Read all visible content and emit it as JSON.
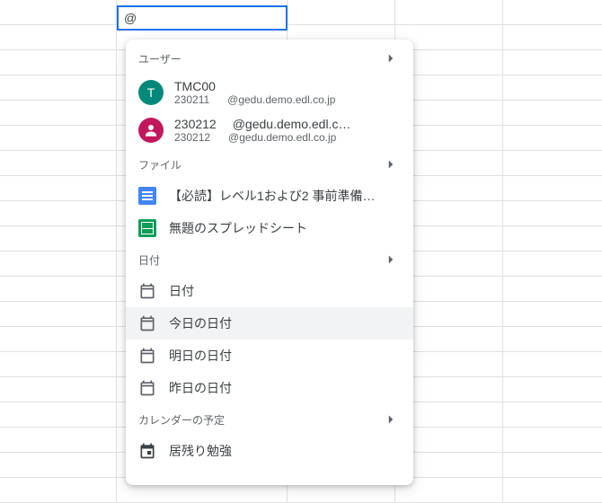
{
  "cell": {
    "value": "@"
  },
  "dropdown": {
    "sections": {
      "users": {
        "header": "ユーザー",
        "items": [
          {
            "avatar_letter": "T",
            "name": "TMC00",
            "sub_id": "230211",
            "email": "@gedu.demo.edl.co.jp"
          },
          {
            "name": "230212",
            "email": "@gedu.demo.edl.c…",
            "sub_id": "230212",
            "sub_email": "@gedu.demo.edl.co.jp"
          }
        ]
      },
      "files": {
        "header": "ファイル",
        "items": [
          {
            "type": "doc",
            "label": "【必読】レベル1および2 事前準備…"
          },
          {
            "type": "sheet",
            "label": "無題のスプレッドシート"
          }
        ]
      },
      "dates": {
        "header": "日付",
        "items": [
          {
            "label": "日付",
            "hover": false
          },
          {
            "label": "今日の日付",
            "hover": true
          },
          {
            "label": "明日の日付",
            "hover": false
          },
          {
            "label": "昨日の日付",
            "hover": false
          }
        ]
      },
      "calendar": {
        "header": "カレンダーの予定",
        "items": [
          {
            "label": "居残り勉強"
          }
        ]
      }
    }
  }
}
